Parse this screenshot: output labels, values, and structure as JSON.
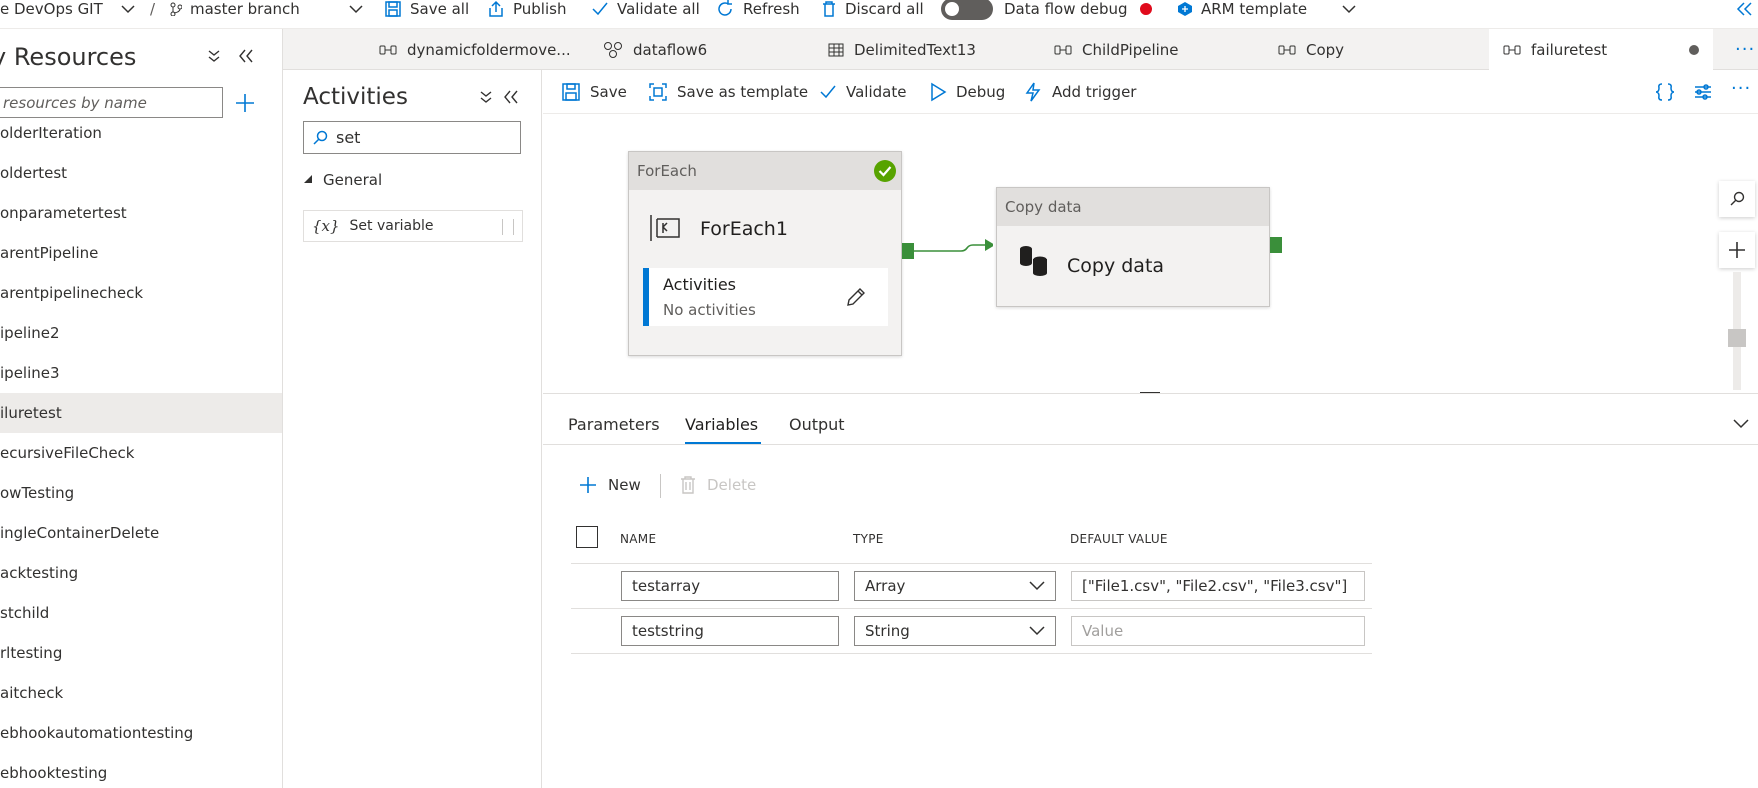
{
  "topbar": {
    "repo": "e DevOps GIT",
    "branch": "master branch",
    "save_all": "Save all",
    "publish": "Publish",
    "validate_all": "Validate all",
    "refresh": "Refresh",
    "discard_all": "Discard all",
    "data_flow_debug": "Data flow debug",
    "arm_template": "ARM template"
  },
  "left": {
    "title": "y Resources",
    "filter_placeholder": "resources by name",
    "items": [
      {
        "label": "olderIteration"
      },
      {
        "label": "oldertest"
      },
      {
        "label": "onparametertest"
      },
      {
        "label": "arentPipeline"
      },
      {
        "label": "arentpipelinecheck"
      },
      {
        "label": "ipeline2"
      },
      {
        "label": "ipeline3"
      },
      {
        "label": "iluretest"
      },
      {
        "label": "ecursiveFileCheck"
      },
      {
        "label": "owTesting"
      },
      {
        "label": "ingleContainerDelete"
      },
      {
        "label": "acktesting"
      },
      {
        "label": "stchild"
      },
      {
        "label": "rltesting"
      },
      {
        "label": "aitcheck"
      },
      {
        "label": "ebhookautomationtesting"
      },
      {
        "label": "ebhooktesting"
      }
    ]
  },
  "tabs": [
    {
      "label": "dynamicfoldermove...",
      "icon": "pipeline-icon"
    },
    {
      "label": "dataflow6",
      "icon": "dataflow-icon"
    },
    {
      "label": "DelimitedText13",
      "icon": "table-icon"
    },
    {
      "label": "ChildPipeline",
      "icon": "pipeline-icon"
    },
    {
      "label": "Copy",
      "icon": "pipeline-icon"
    },
    {
      "label": "failuretest",
      "icon": "pipeline-icon"
    }
  ],
  "activities": {
    "title": "Activities",
    "search_value": "set",
    "group": "General",
    "item": "Set variable"
  },
  "pipeline_toolbar": {
    "save": "Save",
    "save_as_template": "Save as template",
    "validate": "Validate",
    "debug": "Debug",
    "add_trigger": "Add trigger"
  },
  "canvas": {
    "foreach": {
      "header": "ForEach",
      "name": "ForEach1",
      "activities_label": "Activities",
      "activities_value": "No activities"
    },
    "copy": {
      "header": "Copy data",
      "name": "Copy data"
    }
  },
  "bottom": {
    "tabs": [
      "Parameters",
      "Variables",
      "Output"
    ],
    "new": "New",
    "delete": "Delete",
    "columns": [
      "NAME",
      "TYPE",
      "DEFAULT VALUE"
    ],
    "rows": [
      {
        "name": "testarray",
        "type": "Array",
        "default": "[\"File1.csv\", \"File2.csv\", \"File3.csv\"]"
      },
      {
        "name": "teststring",
        "type": "String",
        "default": "Value"
      }
    ]
  },
  "colors": {
    "accent": "#0078d4",
    "success": "#57a300",
    "port": "#3a8f3a",
    "debug_off": "#e00b1c"
  }
}
